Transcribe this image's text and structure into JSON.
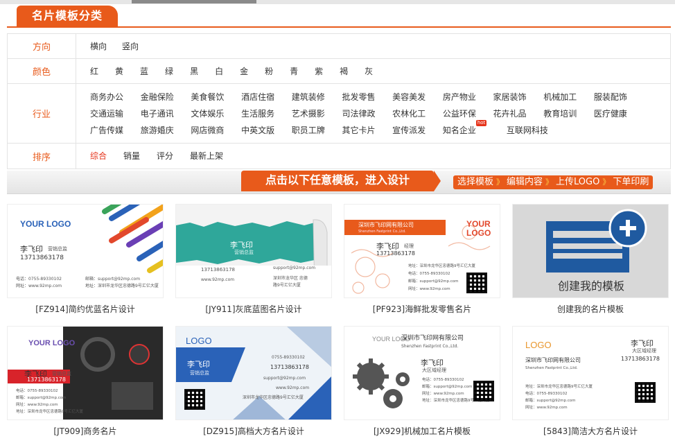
{
  "section_title": "名片模板分类",
  "filters": {
    "direction": {
      "label": "方向",
      "options": [
        "横向",
        "竖向"
      ]
    },
    "color": {
      "label": "颜色",
      "options": [
        "红",
        "黄",
        "蓝",
        "绿",
        "黑",
        "白",
        "金",
        "粉",
        "青",
        "紫",
        "褐",
        "灰"
      ]
    },
    "industry": {
      "label": "行业",
      "options": [
        "商务办公",
        "金融保险",
        "美食餐饮",
        "酒店住宿",
        "建筑装修",
        "批发零售",
        "美容美发",
        "房产物业",
        "家居装饰",
        "机械加工",
        "服装配饰",
        "交通运输",
        "电子通讯",
        "文体娱乐",
        "生活服务",
        "艺术摄影",
        "司法律政",
        "农林化工",
        "公益环保",
        "花卉礼品",
        "教育培训",
        "医疗健康",
        "广告传媒",
        "旅游婚庆",
        "网店微商",
        "中英文版",
        "职员工牌",
        "其它卡片",
        "宣传派发",
        "知名企业",
        "互联网科技"
      ],
      "hot_badge": "hot"
    },
    "sort": {
      "label": "排序",
      "options": [
        "综合",
        "销量",
        "评分",
        "最新上架"
      ],
      "active": "综合"
    }
  },
  "banner": {
    "main": "点击以下任意模板，进入设计",
    "steps": [
      "选择模板",
      "编辑内容",
      "上传LOGO",
      "下单印刷"
    ],
    "arrow": "》"
  },
  "templates": [
    {
      "caption": "[FZ914]简约优蓝名片设计",
      "logo": "YOUR LOGO",
      "name": "李飞印",
      "title": "营销总监",
      "phone": "13713863178",
      "tel": "电话：0755-89330102",
      "email": "邮箱：support@92mp.com",
      "web": "网址：www.92mp.com",
      "addr": "地址：深圳市龙华区忠德路9号汇亿大厦"
    },
    {
      "caption": "[JY911]灰底蓝图名片设计",
      "name": "李飞印",
      "title": "营销总监",
      "phone": "13713863178",
      "email": "support@92mp.com",
      "web": "www.92mp.com",
      "addr": "深圳市龙华区 忠德路9号汇亿大厦"
    },
    {
      "caption": "[PF923]海鲜批发零售名片",
      "company": "深圳市飞印网有限公司",
      "company_en": "Shenzhen Fastprint Co.,Ltd.",
      "logo": "YOUR LOGO",
      "name": "李飞印",
      "title": "经理",
      "phone": "13713863178",
      "tel": "电话：0755-89330102",
      "email": "邮箱：support@92mp.com",
      "web": "网址：www.92mp.com",
      "addr": "地址：深圳市龙华区忠德路9号汇亿大厦"
    },
    {
      "caption": "创建我的名片模板",
      "label": "创建我的模板"
    },
    {
      "caption": "[JT909]商务名片",
      "logo": "YOUR LOGO",
      "name": "李飞印",
      "title": "营销总监",
      "phone": "13713863178",
      "tel": "电话：0755-89330102",
      "email": "邮箱：support@92mp.com",
      "web": "网址：www.92mp.com",
      "addr": "地址：深圳市龙华区忠德路9号汇亿大厦"
    },
    {
      "caption": "[DZ915]高档大方名片设计",
      "logo": "LOGO",
      "name": "李飞印",
      "title": "营销总监",
      "tel": "0755-89330102",
      "phone": "13713863178",
      "email": "support@92mp.com",
      "web": "www.92mp.com",
      "addr": "深圳市龙华区忠德路9号汇亿大厦"
    },
    {
      "caption": "[JX929]机械加工名片模板",
      "logo": "YOUR LOGO",
      "company": "深圳市飞印网有限公司",
      "company_en": "Shenzhen Fastprint Co.,Ltd.",
      "name": "李飞印",
      "title": "大区域经理",
      "tel": "电话：0755-89330102",
      "email": "邮箱：support@92mp.com",
      "web": "网址：www.92mp.com",
      "addr": "地址：深圳市龙华区忠德路9号汇亿大厦"
    },
    {
      "caption": "[5843]简洁大方名片设计",
      "logo": "LOGO",
      "company": "深圳市飞印网有限公司",
      "company_en": "Shenzhen Fastprint Co.,Ltd.",
      "name": "李飞印",
      "title": "大区域经理",
      "phone": "13713863178",
      "addr": "地址：深圳市龙华区忠德路9号汇亿大厦",
      "tel": "电话：0755-89330102",
      "email": "邮箱：support@92mp.com",
      "web": "网址：www.92mp.com"
    }
  ],
  "colors": {
    "accent": "#e85a1b",
    "active": "#e6331a",
    "blue": "#2a62b8"
  }
}
